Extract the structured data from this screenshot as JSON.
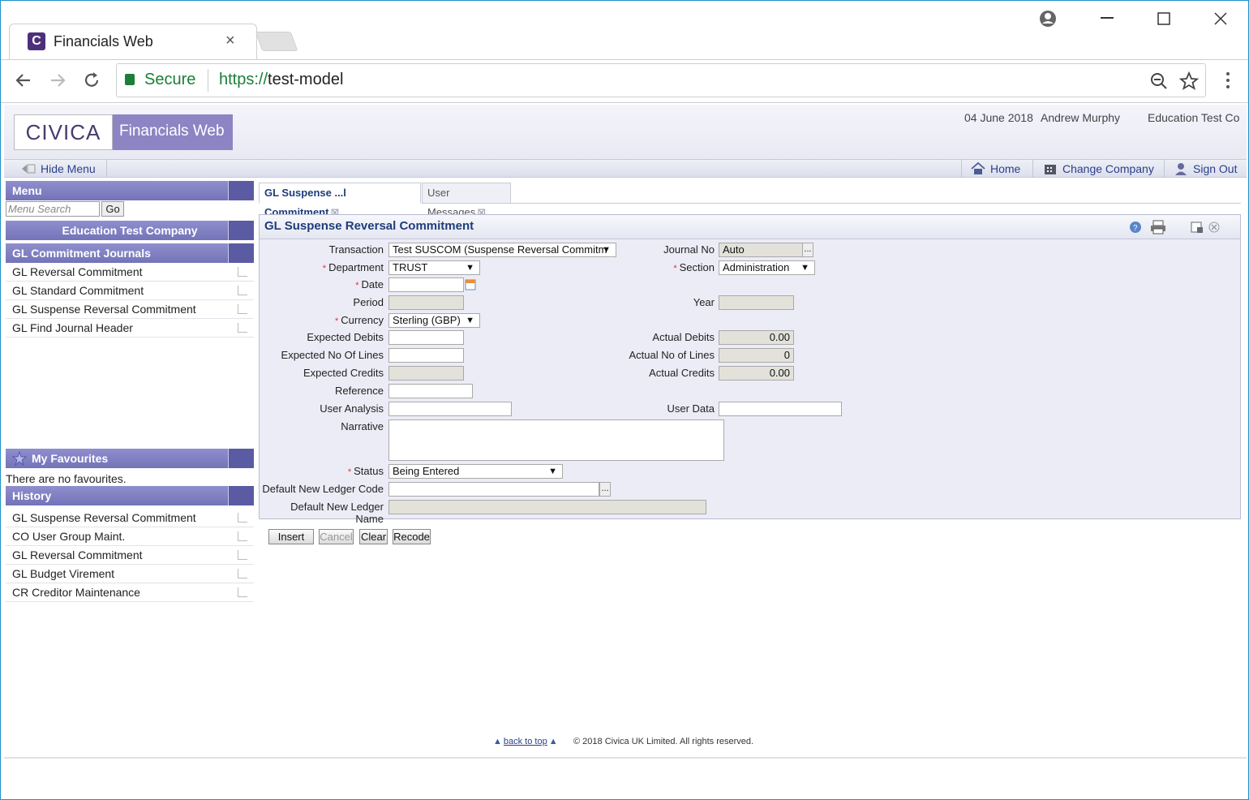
{
  "browser": {
    "tab_title": "Financials Web",
    "tab_icon_letter": "C",
    "tab_close": "×",
    "secure_label": "Secure",
    "url_protocol": "https://",
    "url_host": "test-model",
    "icons": [
      "account-icon",
      "minimize-icon",
      "maximize-icon",
      "close-icon",
      "back-icon",
      "forward-icon",
      "reload-icon",
      "lock-icon",
      "zoom-icon",
      "star-icon",
      "kebab-menu-icon"
    ]
  },
  "app": {
    "logo_left": "CIVICA",
    "logo_right": "Financials Web",
    "date": "04 June 2018",
    "user": "Andrew Murphy",
    "company": "Education Test Co"
  },
  "menubar": {
    "hide_menu": "Hide Menu",
    "home": "Home",
    "change_company": "Change Company",
    "sign_out": "Sign Out"
  },
  "sidebar": {
    "menu_title": "Menu",
    "search_placeholder": "Menu Search",
    "go_label": "Go",
    "company_title": "Education Test Company",
    "journals_title": "GL Commitment Journals",
    "journal_items": [
      "GL Reversal Commitment",
      "GL Standard Commitment",
      "GL Suspense Reversal Commitment",
      "GL Find Journal Header"
    ],
    "favourites_title": "My Favourites",
    "favourites_empty": "There are no favourites.",
    "history_title": "History",
    "history_items": [
      "GL Suspense Reversal Commitment",
      "CO User Group Maint.",
      "GL Reversal Commitment",
      "GL Budget Virement",
      "CR Creditor Maintenance"
    ]
  },
  "tabs": [
    {
      "label": "GL Suspense ...l Commitment",
      "active": true
    },
    {
      "label": "User Messages",
      "active": false
    }
  ],
  "form": {
    "title": "GL Suspense Reversal Commitment",
    "transaction_label": "Transaction",
    "transaction_value": "Test SUSCOM (Suspense Reversal Commitm",
    "journal_no_label": "Journal No",
    "journal_no_value": "Auto",
    "department_label": "Department",
    "department_value": "TRUST",
    "section_label": "Section",
    "section_value": "Administration",
    "date_label": "Date",
    "date_value": "",
    "period_label": "Period",
    "year_label": "Year",
    "currency_label": "Currency",
    "currency_value": "Sterling (GBP)",
    "expected_debits_label": "Expected Debits",
    "actual_debits_label": "Actual Debits",
    "actual_debits_value": "0.00",
    "expected_lines_label": "Expected No Of Lines",
    "actual_lines_label": "Actual No of Lines",
    "actual_lines_value": "0",
    "expected_credits_label": "Expected Credits",
    "actual_credits_label": "Actual Credits",
    "actual_credits_value": "0.00",
    "reference_label": "Reference",
    "user_analysis_label": "User Analysis",
    "user_data_label": "User Data",
    "narrative_label": "Narrative",
    "status_label": "Status",
    "status_value": "Being Entered",
    "default_ledger_code_label": "Default New Ledger Code",
    "default_ledger_name_label": "Default New Ledger Name",
    "required_mark": "*",
    "dots": "..."
  },
  "buttons": {
    "insert": "Insert",
    "cancel": "Cancel",
    "clear": "Clear",
    "recode": "Recode"
  },
  "footer": {
    "back_to_top": "back to top",
    "copyright": "© 2018 Civica UK Limited. All rights reserved."
  },
  "colors": {
    "accent": "#7373b8",
    "brand": "#4d2f7c",
    "secure": "#1a7f37",
    "link": "#2b3f8a"
  }
}
